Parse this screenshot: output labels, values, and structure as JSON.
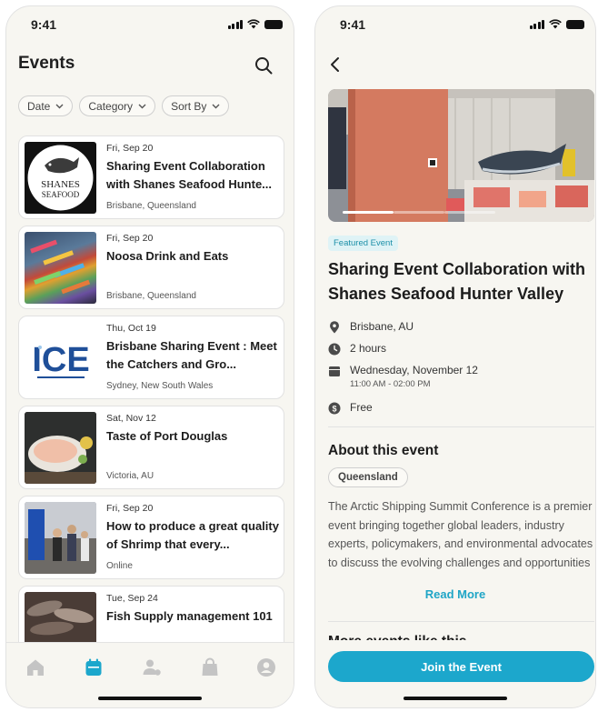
{
  "status_bar": {
    "time": "9:41"
  },
  "events_screen": {
    "title": "Events",
    "filters": [
      {
        "label": "Date"
      },
      {
        "label": "Category"
      },
      {
        "label": "Sort By"
      }
    ],
    "events": [
      {
        "date": "Fri, Sep 20",
        "title": "Sharing Event Collaboration with Shanes Seafood Hunte...",
        "location": "Brisbane, Queensland",
        "thumb_logo": {
          "line1": "SHANES",
          "line2": "SEAFOOD"
        }
      },
      {
        "date": "Fri, Sep 20",
        "title": "Noosa Drink and Eats",
        "location": "Brisbane, Queensland"
      },
      {
        "date": "Thu, Oct 19",
        "title": "Brisbane Sharing Event : Meet the Catchers and Gro...",
        "location": "Sydney, New South Wales",
        "thumb_logo": {
          "text": "ICE"
        }
      },
      {
        "date": "Sat, Nov 12",
        "title": "Taste of Port Douglas",
        "location": "Victoria, AU"
      },
      {
        "date": "Fri, Sep 20",
        "title": "How to produce a great quality of Shrimp that every...",
        "location": "Online"
      },
      {
        "date": "Tue, Sep 24",
        "title": "Fish Supply management 101",
        "location": ""
      }
    ],
    "tabs": [
      {
        "icon": "home-icon",
        "active": false
      },
      {
        "icon": "calendar-icon",
        "active": true
      },
      {
        "icon": "people-icon",
        "active": false
      },
      {
        "icon": "bag-icon",
        "active": false
      },
      {
        "icon": "profile-icon",
        "active": false
      }
    ],
    "colors": {
      "accent": "#1ca7cc",
      "inactive_icon": "#c4c4c4"
    }
  },
  "detail_screen": {
    "badge": "Featured Event",
    "title": "Sharing Event Collaboration with Shanes Seafood Hunter Valley",
    "location": "Brisbane, AU",
    "duration": "2 hours",
    "date": "Wednesday, November 12",
    "time": "11:00 AM - 02:00 PM",
    "price": "Free",
    "about_heading": "About this event",
    "region_tag": "Queensland",
    "about_text": "The Arctic Shipping Summit Conference is a premier event bringing together global leaders, industry experts, policymakers, and environmental advocates to discuss the evolving challenges and opportunities of Arctic shipping.",
    "read_more": "Read More",
    "more_heading": "More events like this",
    "join_button": "Join the Event",
    "carousel": {
      "slides": 3,
      "active": 0
    }
  }
}
